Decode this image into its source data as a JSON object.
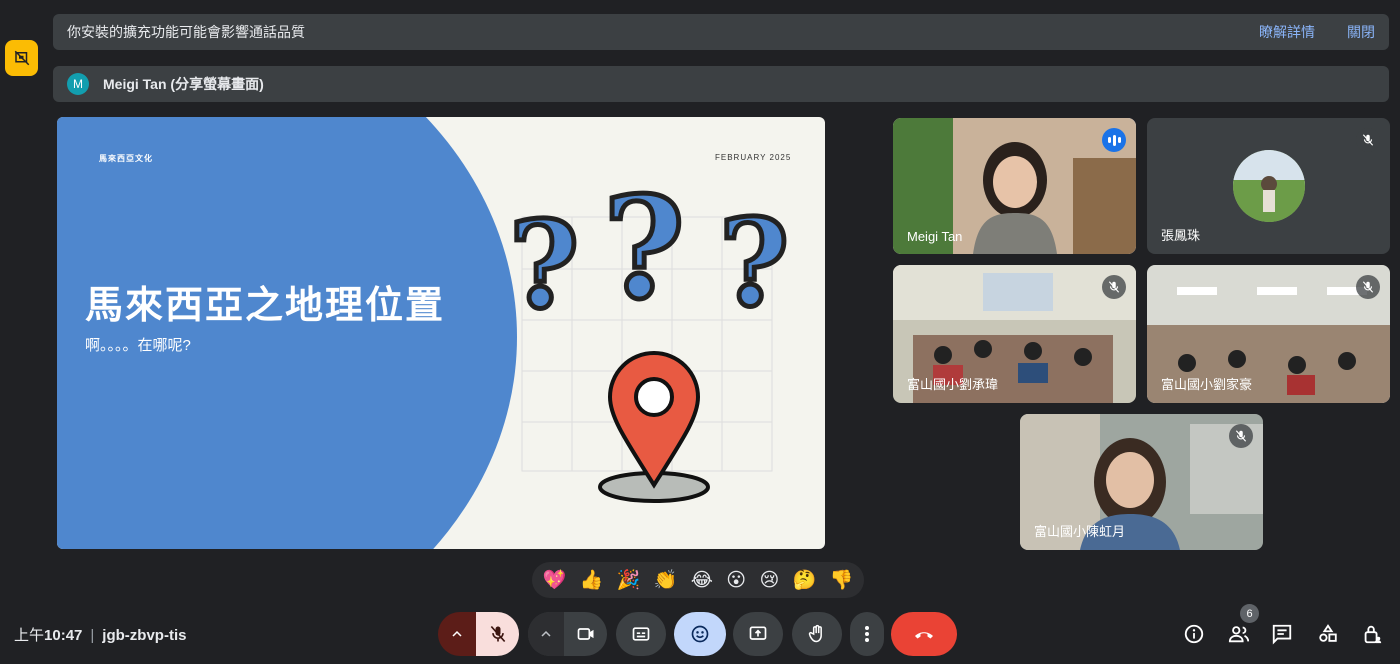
{
  "notice": {
    "message": "你安裝的擴充功能可能會影響通話品質",
    "details_link": "瞭解詳情",
    "close_link": "關閉"
  },
  "presenter_bar": {
    "avatar_letter": "M",
    "label": "Meigi Tan (分享螢幕畫面)"
  },
  "slide": {
    "brand": "馬來西亞文化",
    "date": "FEBRUARY 2025",
    "title": "馬來西亞之地理位置",
    "subtitle": "啊。。。。在哪呢?"
  },
  "participants": [
    {
      "name": "Meigi Tan",
      "speaking": true
    },
    {
      "name": "張鳳珠",
      "muted": true
    },
    {
      "name": "富山國小劉承瑋",
      "muted": true
    },
    {
      "name": "富山國小劉家豪",
      "muted": true
    },
    {
      "name": "富山國小陳虹月",
      "muted": true
    }
  ],
  "reactions": [
    "💖",
    "👍",
    "🎉",
    "👏",
    "😂",
    "😮",
    "😢",
    "🤔",
    "👎"
  ],
  "meeting": {
    "time_prefix": "上午",
    "time": "10:47",
    "code": "jgb-zbvp-tis"
  },
  "participant_count": "6",
  "colors": {
    "background": "#202124",
    "accent": "#8ab4f8",
    "end_call": "#ea4335",
    "warning": "#fbbc04",
    "slide_blue": "#4f87ce"
  }
}
